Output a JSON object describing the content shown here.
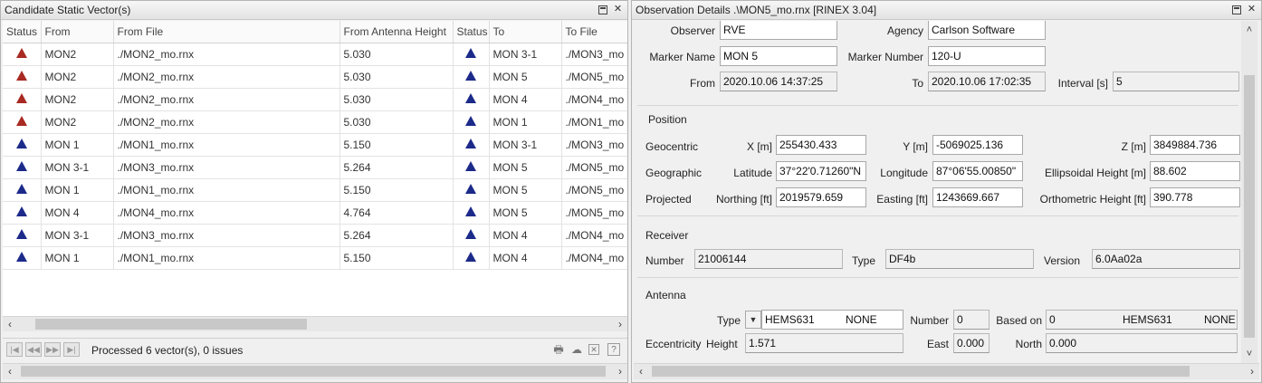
{
  "left_panel": {
    "title": "Candidate Static Vector(s)",
    "columns": [
      "Status",
      "From",
      "From File",
      "From Antenna Height",
      "Status",
      "To",
      "To File"
    ],
    "rows": [
      {
        "from_status": "red",
        "from": "MON2",
        "from_file": "./MON2_mo.rnx",
        "height": "5.030",
        "to_status": "blue",
        "to": "MON 3-1",
        "to_file": "./MON3_mo"
      },
      {
        "from_status": "red",
        "from": "MON2",
        "from_file": "./MON2_mo.rnx",
        "height": "5.030",
        "to_status": "blue",
        "to": "MON 5",
        "to_file": "./MON5_mo"
      },
      {
        "from_status": "red",
        "from": "MON2",
        "from_file": "./MON2_mo.rnx",
        "height": "5.030",
        "to_status": "blue",
        "to": "MON 4",
        "to_file": "./MON4_mo"
      },
      {
        "from_status": "red",
        "from": "MON2",
        "from_file": "./MON2_mo.rnx",
        "height": "5.030",
        "to_status": "blue",
        "to": "MON 1",
        "to_file": "./MON1_mo"
      },
      {
        "from_status": "blue",
        "from": "MON 1",
        "from_file": "./MON1_mo.rnx",
        "height": "5.150",
        "to_status": "blue",
        "to": "MON 3-1",
        "to_file": "./MON3_mo"
      },
      {
        "from_status": "blue",
        "from": "MON 3-1",
        "from_file": "./MON3_mo.rnx",
        "height": "5.264",
        "to_status": "blue",
        "to": "MON 5",
        "to_file": "./MON5_mo"
      },
      {
        "from_status": "blue",
        "from": "MON 1",
        "from_file": "./MON1_mo.rnx",
        "height": "5.150",
        "to_status": "blue",
        "to": "MON 5",
        "to_file": "./MON5_mo"
      },
      {
        "from_status": "blue",
        "from": "MON 4",
        "from_file": "./MON4_mo.rnx",
        "height": "4.764",
        "to_status": "blue",
        "to": "MON 5",
        "to_file": "./MON5_mo"
      },
      {
        "from_status": "blue",
        "from": "MON 3-1",
        "from_file": "./MON3_mo.rnx",
        "height": "5.264",
        "to_status": "blue",
        "to": "MON 4",
        "to_file": "./MON4_mo"
      },
      {
        "from_status": "blue",
        "from": "MON 1",
        "from_file": "./MON1_mo.rnx",
        "height": "5.150",
        "to_status": "blue",
        "to": "MON 4",
        "to_file": "./MON4_mo"
      }
    ],
    "status_text": "Processed 6 vector(s), 0 issues",
    "icons": [
      "first-page-icon",
      "prev-page-icon",
      "next-page-icon",
      "last-page-icon",
      "printer-icon",
      "cloud-icon",
      "export-icon",
      "help-icon"
    ]
  },
  "right_panel": {
    "title": "Observation Details .\\MON5_mo.rnx [RINEX 3.04]",
    "observer": {
      "label": "Observer",
      "value": "RVE"
    },
    "agency": {
      "label": "Agency",
      "value": "Carlson Software"
    },
    "marker_name": {
      "label": "Marker Name",
      "value": "MON 5"
    },
    "marker_number": {
      "label": "Marker Number",
      "value": "120-U"
    },
    "from": {
      "label": "From",
      "value": "2020.10.06 14:37:25"
    },
    "to": {
      "label": "To",
      "value": "2020.10.06 17:02:35"
    },
    "interval": {
      "label": "Interval [s]",
      "value": "5"
    },
    "position": {
      "title": "Position",
      "geocentric": {
        "label": "Geocentric",
        "x_label": "X [m]",
        "x": "255430.433",
        "y_label": "Y [m]",
        "y": "-5069025.136",
        "z_label": "Z [m]",
        "z": "3849884.736"
      },
      "geographic": {
        "label": "Geographic",
        "lat_label": "Latitude",
        "lat": "37°22'0.71260\"N",
        "lon_label": "Longitude",
        "lon": "87°06'55.00850\"",
        "h_label": "Ellipsoidal Height [m]",
        "h": "88.602"
      },
      "projected": {
        "label": "Projected",
        "n_label": "Northing [ft]",
        "n": "2019579.659",
        "e_label": "Easting [ft]",
        "e": "1243669.667",
        "oh_label": "Orthometric Height [ft]",
        "oh": "390.778"
      }
    },
    "receiver": {
      "title": "Receiver",
      "number_label": "Number",
      "number": "21006144",
      "type_label": "Type",
      "type": "DF4b",
      "version_label": "Version",
      "version": "6.0Aa02a"
    },
    "antenna": {
      "title": "Antenna",
      "type_label": "Type",
      "type": "HEMS631",
      "type_radome": "NONE",
      "number_label": "Number",
      "number": "0",
      "based_on_label": "Based on",
      "based_on": "0",
      "based_on_type": "HEMS631",
      "based_on_radome": "NONE",
      "eccentricity_label": "Eccentricity",
      "height_label": "Height",
      "height": "1.571",
      "east_label": "East",
      "east": "0.000",
      "north_label": "North",
      "north": "0.000"
    }
  },
  "colors": {
    "status_red": "#a82a22",
    "status_blue": "#1c2a8a"
  }
}
